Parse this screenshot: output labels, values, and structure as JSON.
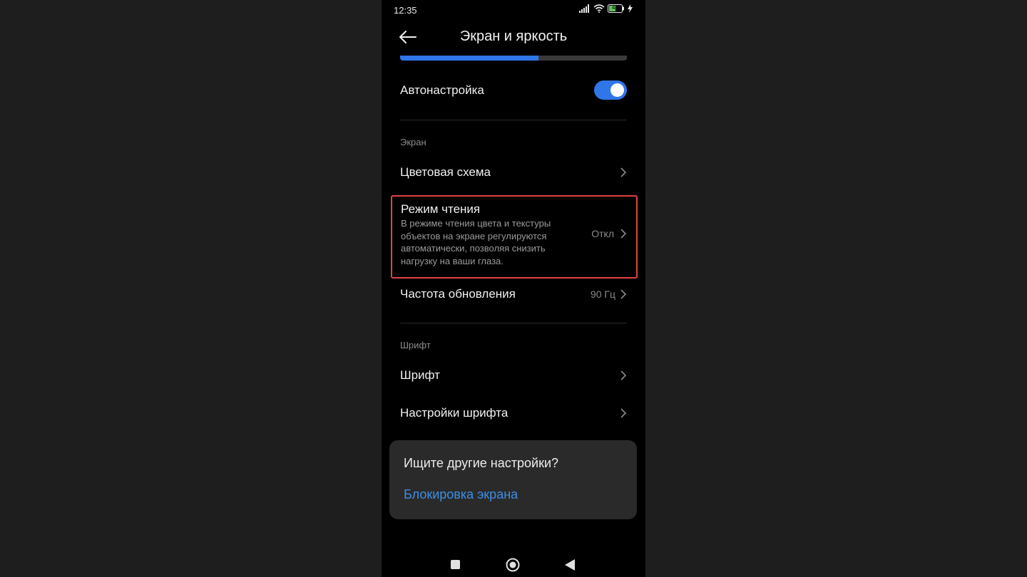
{
  "status_bar": {
    "time": "12:35",
    "battery_level": "44"
  },
  "header": {
    "title": "Экран и яркость"
  },
  "brightness": {
    "level": 0.61
  },
  "auto_brightness": {
    "label": "Автонастройка",
    "enabled": true
  },
  "sections": {
    "screen": "Экран",
    "font": "Шрифт"
  },
  "items": {
    "color_scheme": {
      "label": "Цветовая схема"
    },
    "reading_mode": {
      "label": "Режим чтения",
      "description": "В режиме чтения цвета и текстуры объектов на экране регулируются автоматически, позволяя снизить нагрузку на ваши глаза.",
      "value": "Откл"
    },
    "refresh_rate": {
      "label": "Частота обновления",
      "value": "90 Гц"
    },
    "font": {
      "label": "Шрифт"
    },
    "font_settings": {
      "label": "Настройки шрифта"
    }
  },
  "suggestions": {
    "title": "Ищите другие настройки?",
    "link": "Блокировка экрана"
  },
  "colors": {
    "accent": "#2f76e8",
    "link": "#3c8ee6",
    "highlight_border": "#e0443f",
    "background": "#000000"
  }
}
